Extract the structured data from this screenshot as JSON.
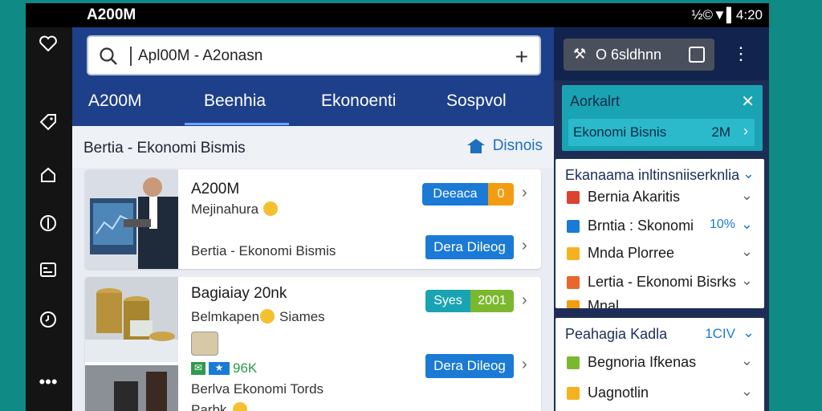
{
  "status_bar": {
    "time": "A200M",
    "indicators": "½©▼▌4:20"
  },
  "left_rail": {
    "icons": [
      "heart-icon",
      "tag-icon",
      "home-icon",
      "compass-icon",
      "card-icon",
      "clock-icon",
      "more-icon"
    ]
  },
  "search": {
    "value": "Apl00M - A2onasn"
  },
  "tabs": [
    {
      "label": "A200M"
    },
    {
      "label": "Beenhia"
    },
    {
      "label": "Ekonoenti"
    },
    {
      "label": "Sospvol"
    }
  ],
  "section": {
    "title": "Bertia - Ekonomi Bismis",
    "link_label": "Disnois"
  },
  "cards": [
    {
      "title": "A200M",
      "subtitle": "Mejinahura",
      "meta": "Bertia - Ekonomi Bismis",
      "badge_label": "Deeaca",
      "badge_value": "0",
      "badge_color": "#1a7ad6",
      "badge_value_color": "#f39c12",
      "button_label": "Dera Dileog"
    },
    {
      "title": "Bagiaiay 20nk",
      "subtitle": "Belmkapen",
      "subtitle2": "Siames",
      "meta_tags": [
        "✉",
        "★",
        "96K"
      ],
      "meta": "Berlva Ekonomi Tords",
      "meta2": "Parbk",
      "badge_label": "Syes",
      "badge_value": "2001",
      "badge_color": "#1aa3b2",
      "badge_value_color": "#7cb82f",
      "button_label": "Dera Dileog"
    }
  ],
  "right_panel": {
    "pill_label": "O 6sldhnn",
    "teal_box": {
      "header": "Aorkalrt",
      "item_label": "Ekonomi Bisnis",
      "item_value": "2M"
    },
    "card1": {
      "header": "Ekanaama inltinsniiserknlia",
      "items": [
        {
          "label": "Bernia Akaritis",
          "color": "#d9432f",
          "value": ""
        },
        {
          "label": "Brntia : Skonomi",
          "color": "#1a7ad6",
          "value": "10%"
        },
        {
          "label": "Mnda Plorree",
          "color": "#f5b21f",
          "value": ""
        },
        {
          "label": "Lertia - Ekonomi Bisrks",
          "color": "#e8672a",
          "value": ""
        },
        {
          "label": "Mnal",
          "color": "#f39c12",
          "value": ""
        }
      ]
    },
    "card2": {
      "header": "Peahagia Kadla",
      "header_value": "1CIV",
      "items": [
        {
          "label": "Begnoria Ifkenas",
          "color": "#7cb82f",
          "value": ""
        },
        {
          "label": "Uagnotlin",
          "color": "#f5b21f",
          "value": ""
        }
      ]
    }
  }
}
